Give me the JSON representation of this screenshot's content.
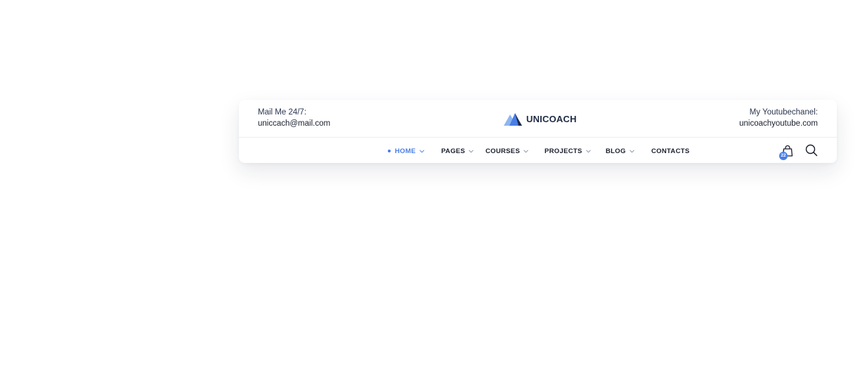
{
  "header": {
    "contact_left": {
      "label": "Mail Me 24/7:",
      "value": "uniccach@mail.com"
    },
    "contact_right": {
      "label": "My Youtubechanel:",
      "value": "unicoachyoutube.com"
    },
    "logo": {
      "text": "UNICOACH",
      "icon": "mountain-logo-icon",
      "colors": [
        "#8fb6f0",
        "#4a7ee6",
        "#1f2a44"
      ]
    }
  },
  "nav": {
    "items": [
      {
        "label": "HOME",
        "active": true,
        "has_dropdown": true
      },
      {
        "label": "PAGES",
        "active": false,
        "has_dropdown": true
      },
      {
        "label": "COURSES",
        "active": false,
        "has_dropdown": true
      },
      {
        "label": "PROJECTS",
        "active": false,
        "has_dropdown": true
      },
      {
        "label": "BLOG",
        "active": false,
        "has_dropdown": true
      },
      {
        "label": "CONTACTS",
        "active": false,
        "has_dropdown": false
      }
    ],
    "cart": {
      "icon": "shopping-bag-icon",
      "count": "22"
    },
    "search": {
      "icon": "search-icon"
    }
  },
  "colors": {
    "accent": "#4a7ee6",
    "text_dark": "#1a1f2e",
    "background": "#ffffff"
  }
}
